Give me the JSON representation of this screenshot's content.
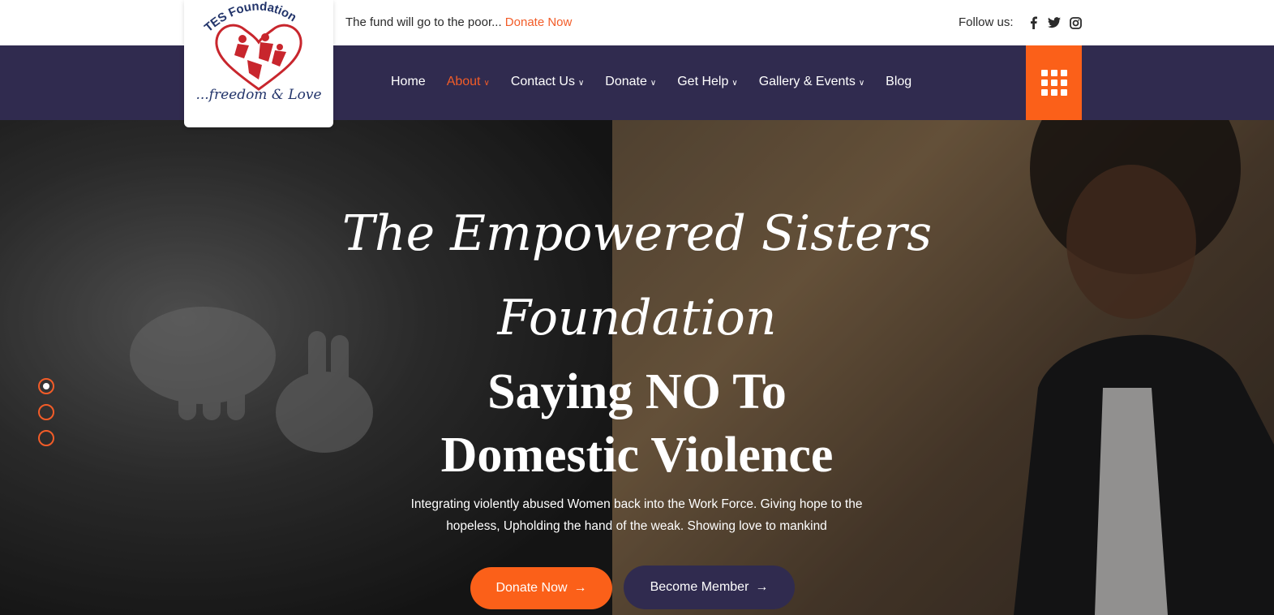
{
  "topbar": {
    "message": "The fund will go to the poor...",
    "donate_link": "Donate Now",
    "follow_label": "Follow us:",
    "socials": [
      "facebook-icon",
      "twitter-icon",
      "instagram-icon"
    ]
  },
  "logo": {
    "name": "TES Foundation",
    "tagline": "...freedom & Love"
  },
  "nav": {
    "items": [
      {
        "label": "Home",
        "dropdown": false,
        "active": false
      },
      {
        "label": "About",
        "dropdown": true,
        "active": true
      },
      {
        "label": "Contact Us",
        "dropdown": true,
        "active": false
      },
      {
        "label": "Donate",
        "dropdown": true,
        "active": false
      },
      {
        "label": "Get Help",
        "dropdown": true,
        "active": false
      },
      {
        "label": "Gallery & Events",
        "dropdown": true,
        "active": false
      },
      {
        "label": "Blog",
        "dropdown": false,
        "active": false
      }
    ],
    "grid_icon": "grid-menu-icon"
  },
  "hero": {
    "script_title_line1": "The Empowered Sisters",
    "script_title_line2": "Foundation",
    "headline_line1": "Saying NO To",
    "headline_line2": "Domestic Violence",
    "subtitle_line1": "Integrating violently abused Women back into the Work Force. Giving hope to the",
    "subtitle_line2": "hopeless, Upholding the hand of the weak. Showing love to mankind",
    "primary_button": "Donate Now",
    "secondary_button": "Become Member",
    "slide_count": 3,
    "active_slide": 1
  },
  "colors": {
    "accent": "#fb6019",
    "nav_bg": "#302b4f",
    "link": "#f25c28"
  }
}
